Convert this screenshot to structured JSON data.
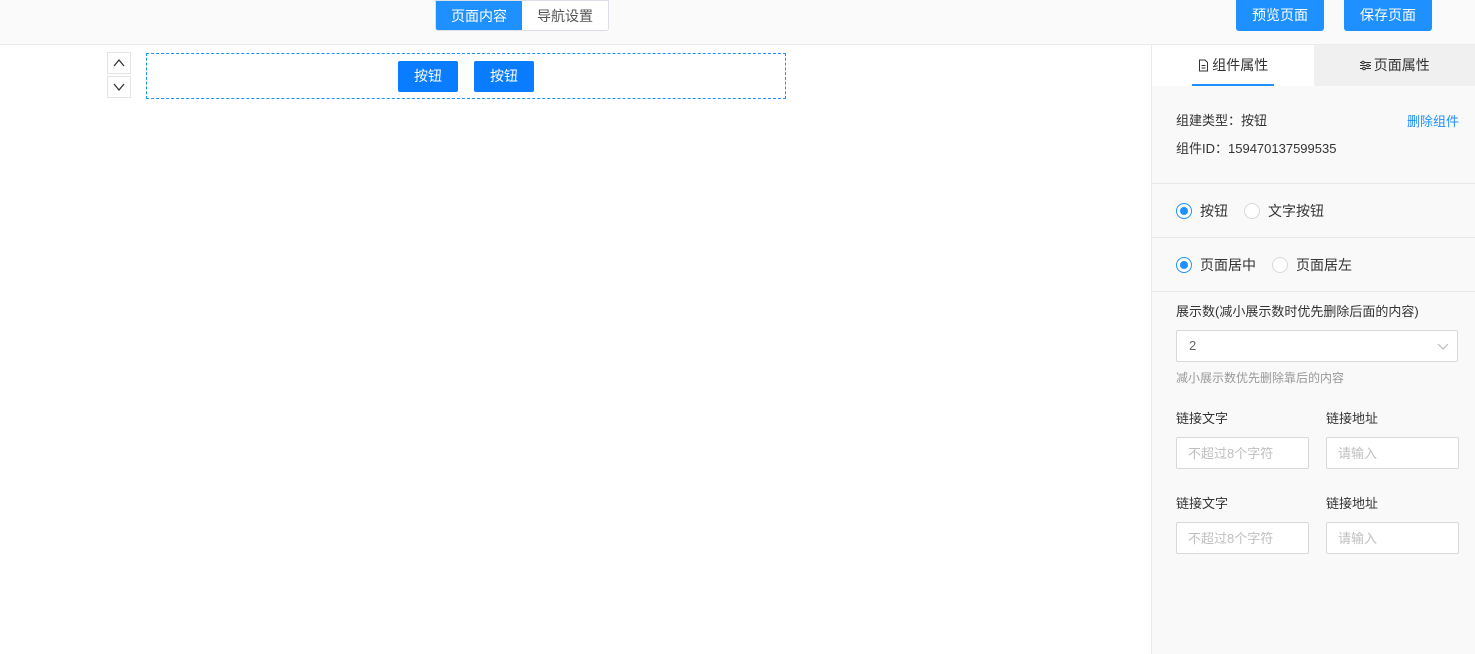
{
  "header": {
    "tabs": [
      {
        "label": "页面内容",
        "active": true
      },
      {
        "label": "导航设置",
        "active": false
      }
    ],
    "preview_label": "预览页面",
    "save_label": "保存页面"
  },
  "canvas": {
    "component_buttons": [
      "按钮",
      "按钮"
    ]
  },
  "panel": {
    "tabs": [
      {
        "label": "组件属性",
        "icon": "document-icon",
        "active": true
      },
      {
        "label": "页面属性",
        "icon": "sliders-icon",
        "active": false
      }
    ],
    "component_type": "组建类型：按钮",
    "component_id": "组件ID：159470137599535",
    "delete_label": "删除组件",
    "style_options": [
      {
        "label": "按钮",
        "checked": true
      },
      {
        "label": "文字按钮",
        "checked": false
      }
    ],
    "align_options": [
      {
        "label": "页面居中",
        "checked": true
      },
      {
        "label": "页面居左",
        "checked": false
      }
    ],
    "count_label": "展示数(减小展示数时优先删除后面的内容)",
    "count_value": "2",
    "count_hint": "减小展示数优先删除靠后的内容",
    "links": [
      {
        "text_label": "链接文字",
        "text_placeholder": "不超过8个字符",
        "url_label": "链接地址",
        "url_placeholder": "请输入"
      },
      {
        "text_label": "链接文字",
        "text_placeholder": "不超过8个字符",
        "url_label": "链接地址",
        "url_placeholder": "请输入"
      }
    ]
  },
  "colors": {
    "accent": "#1e90ff",
    "button": "#0a7cff"
  }
}
